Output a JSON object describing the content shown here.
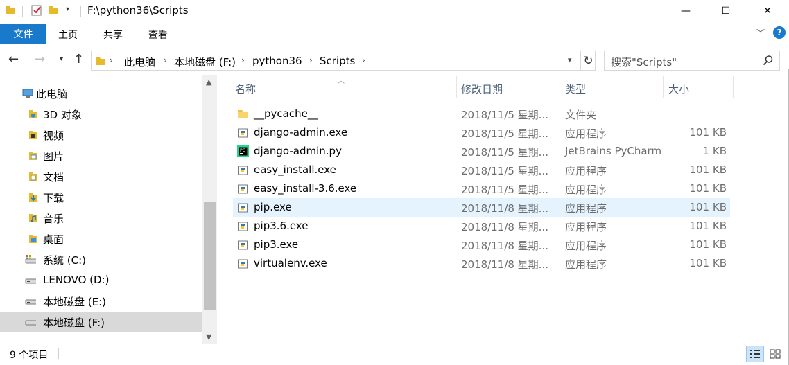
{
  "window": {
    "title": "F:\\python36\\Scripts",
    "controls": {
      "minimize": "—",
      "maximize": "☐",
      "close": "✕"
    }
  },
  "ribbon": {
    "tabs": [
      "文件",
      "主页",
      "共享",
      "查看"
    ]
  },
  "address": {
    "breadcrumbs": [
      "此电脑",
      "本地磁盘 (F:)",
      "python36",
      "Scripts"
    ],
    "search_placeholder": "搜索\"Scripts\""
  },
  "nav": {
    "items": [
      {
        "label": "此电脑",
        "icon": "computer-icon"
      },
      {
        "label": "3D 对象",
        "icon": "3d-objects-icon"
      },
      {
        "label": "视频",
        "icon": "video-folder-icon"
      },
      {
        "label": "图片",
        "icon": "pictures-folder-icon"
      },
      {
        "label": "文档",
        "icon": "documents-folder-icon"
      },
      {
        "label": "下载",
        "icon": "downloads-folder-icon"
      },
      {
        "label": "音乐",
        "icon": "music-folder-icon"
      },
      {
        "label": "桌面",
        "icon": "desktop-folder-icon"
      },
      {
        "label": "系统 (C:)",
        "icon": "system-drive-icon"
      },
      {
        "label": "LENOVO (D:)",
        "icon": "drive-icon"
      },
      {
        "label": "本地磁盘 (E:)",
        "icon": "drive-icon"
      },
      {
        "label": "本地磁盘 (F:)",
        "icon": "drive-icon"
      }
    ],
    "selected": "本地磁盘 (F:)"
  },
  "files": {
    "columns": {
      "name": "名称",
      "date": "修改日期",
      "type": "类型",
      "size": "大小"
    },
    "rows": [
      {
        "name": "__pycache__",
        "date": "2018/11/5 星期...",
        "type": "文件夹",
        "size": "",
        "icon": "folder-icon"
      },
      {
        "name": "django-admin.exe",
        "date": "2018/11/5 星期...",
        "type": "应用程序",
        "size": "101 KB",
        "icon": "python-exe-icon"
      },
      {
        "name": "django-admin.py",
        "date": "2018/11/5 星期...",
        "type": "JetBrains PyCharm",
        "size": "1 KB",
        "icon": "pycharm-file-icon"
      },
      {
        "name": "easy_install.exe",
        "date": "2018/11/5 星期...",
        "type": "应用程序",
        "size": "101 KB",
        "icon": "python-exe-icon"
      },
      {
        "name": "easy_install-3.6.exe",
        "date": "2018/11/5 星期...",
        "type": "应用程序",
        "size": "101 KB",
        "icon": "python-exe-icon"
      },
      {
        "name": "pip.exe",
        "date": "2018/11/8 星期...",
        "type": "应用程序",
        "size": "101 KB",
        "icon": "python-exe-icon"
      },
      {
        "name": "pip3.6.exe",
        "date": "2018/11/8 星期...",
        "type": "应用程序",
        "size": "101 KB",
        "icon": "python-exe-icon"
      },
      {
        "name": "pip3.exe",
        "date": "2018/11/8 星期...",
        "type": "应用程序",
        "size": "101 KB",
        "icon": "python-exe-icon"
      },
      {
        "name": "virtualenv.exe",
        "date": "2018/11/8 星期...",
        "type": "应用程序",
        "size": "101 KB",
        "icon": "python-exe-icon"
      }
    ],
    "hovered": "pip.exe"
  },
  "status": {
    "item_count": "9 个项目"
  },
  "colors": {
    "accent": "#1979ca",
    "hover_row": "#e5f3ff",
    "selected_nav": "#d9d9d9",
    "folder": "#f0c040"
  }
}
